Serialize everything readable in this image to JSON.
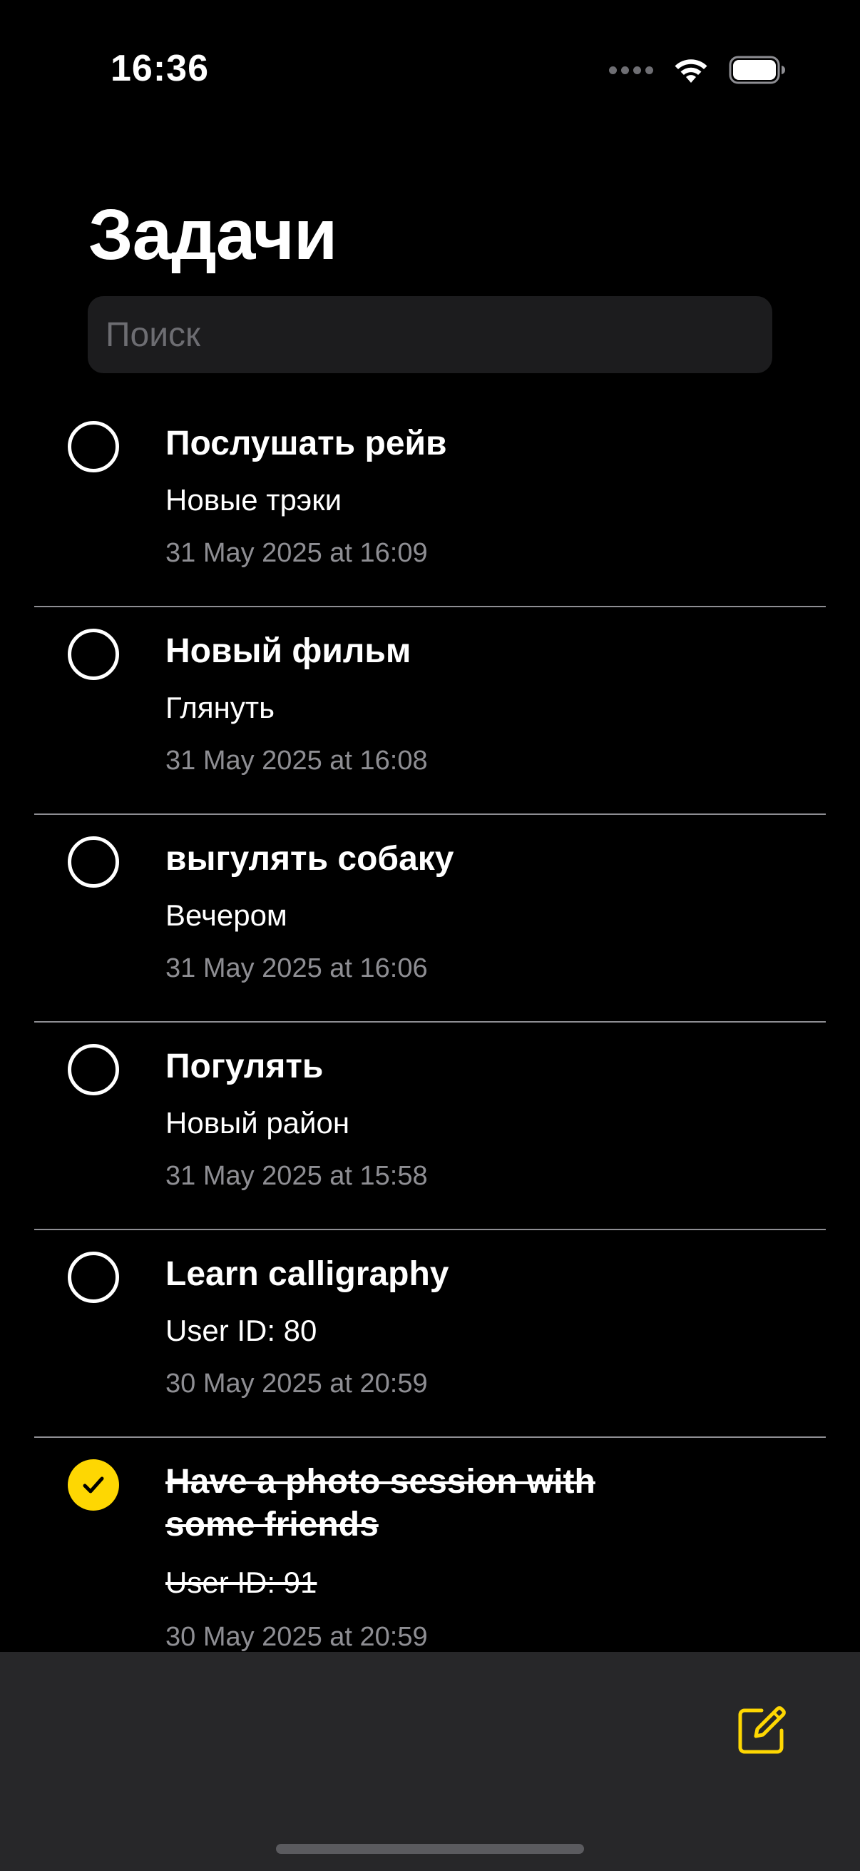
{
  "status_bar": {
    "time": "16:36"
  },
  "header": {
    "title": "Задачи"
  },
  "search": {
    "placeholder": "Поиск",
    "value": ""
  },
  "tasks": [
    {
      "title": "Послушать рейв",
      "description": "Новые трэки",
      "date": "31 May 2025 at 16:09",
      "completed": false
    },
    {
      "title": "Новый фильм",
      "description": "Глянуть",
      "date": "31 May 2025 at 16:08",
      "completed": false
    },
    {
      "title": "выгулять собаку",
      "description": "Вечером",
      "date": "31 May 2025 at 16:06",
      "completed": false
    },
    {
      "title": "Погулять",
      "description": "Новый район",
      "date": "31 May 2025 at 15:58",
      "completed": false
    },
    {
      "title": "Learn calligraphy",
      "description": "User ID: 80",
      "date": "30 May 2025 at 20:59",
      "completed": false
    },
    {
      "title": "Have a photo session with some friends",
      "description": "User ID: 91",
      "date": "30 May 2025 at 20:59",
      "completed": true
    }
  ],
  "toolbar": {
    "compose_icon": "square-and-pencil-icon"
  },
  "colors": {
    "accent": "#FED702",
    "background": "#000000",
    "secondary_text": "#8E8E93",
    "toolbar": "#272729",
    "search_field": "#1C1C1E"
  }
}
